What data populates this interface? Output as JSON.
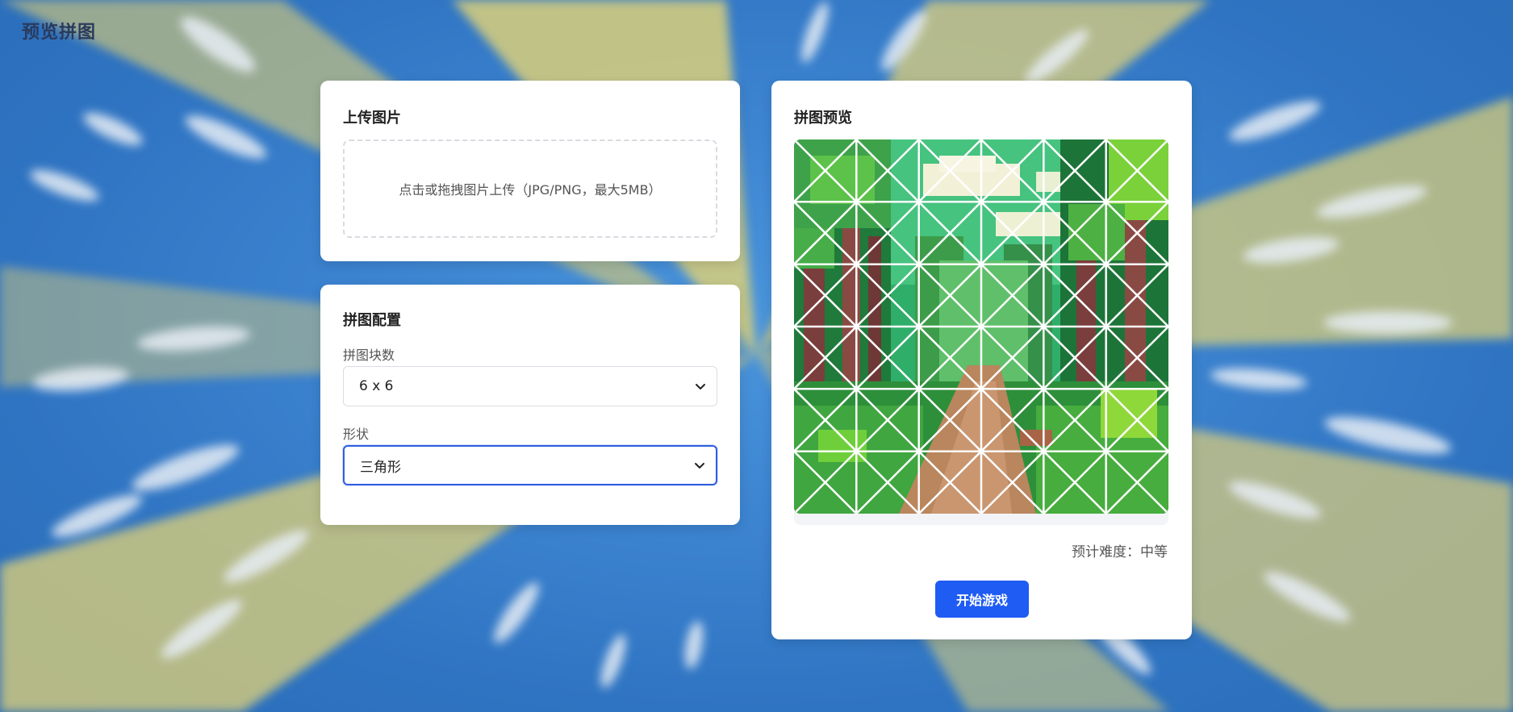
{
  "app": {
    "title": "预览拼图"
  },
  "upload": {
    "title": "上传图片",
    "hint": "点击或拖拽图片上传（JPG/PNG，最大5MB）"
  },
  "config": {
    "title": "拼图配置",
    "pieces_label": "拼图块数",
    "pieces_value": "6 x 6",
    "shape_label": "形状",
    "shape_value": "三角形"
  },
  "preview": {
    "title": "拼图预览",
    "difficulty": "预计难度：中等",
    "start_label": "开始游戏",
    "grid": {
      "rows": 6,
      "cols": 6,
      "shape": "triangle"
    }
  },
  "colors": {
    "accent": "#1f5cf4",
    "focus_border": "#2f5fe0",
    "title_color": "#2b3a5c"
  }
}
